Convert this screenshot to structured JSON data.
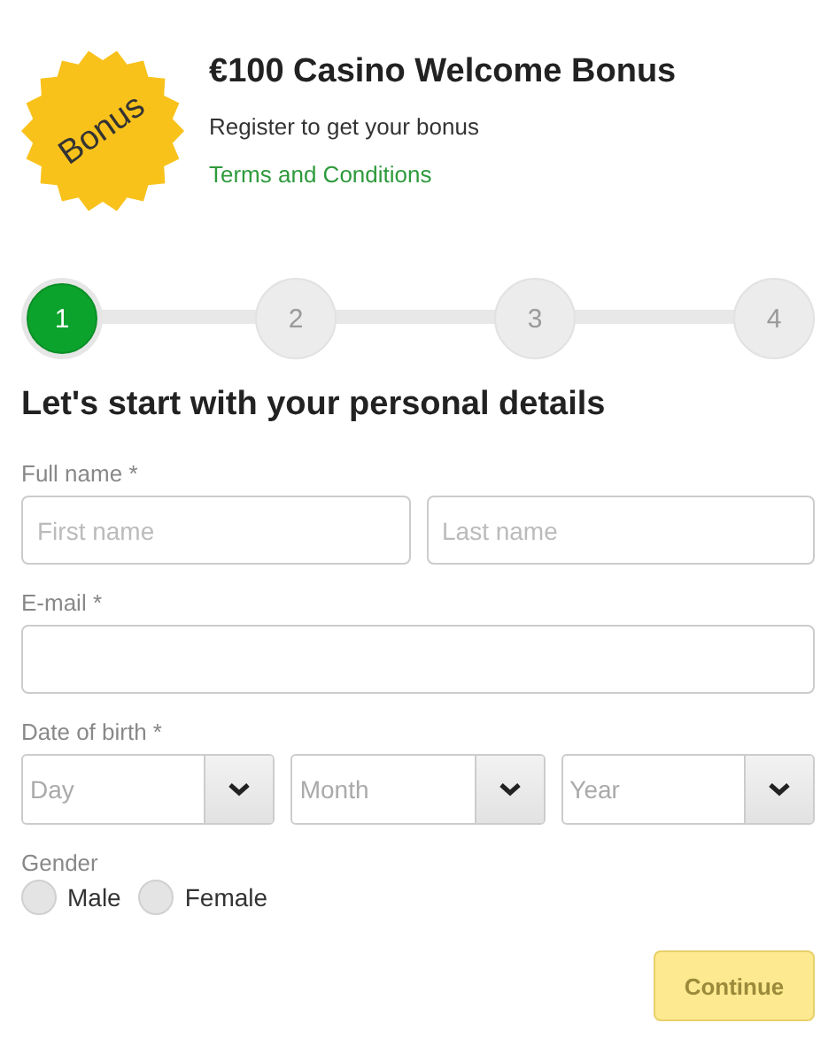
{
  "promo": {
    "badge": "Bonus",
    "title": "€100 Casino Welcome Bonus",
    "subtitle": "Register to get your bonus",
    "link": "Terms and Conditions"
  },
  "steps": [
    {
      "label": "1",
      "selected": true
    },
    {
      "label": "2",
      "selected": false
    },
    {
      "label": "3",
      "selected": false
    },
    {
      "label": "4",
      "selected": false
    }
  ],
  "heading": "Let's start with your personal details",
  "full_name": {
    "label": "Full name *",
    "fields": [
      {
        "placeholder": "First name"
      },
      {
        "placeholder": "Last name"
      }
    ]
  },
  "email": {
    "label": "E-mail *"
  },
  "date_of_birth": {
    "label": "Date of birth *",
    "selects": [
      {
        "placeholder": "Day"
      },
      {
        "placeholder": "Month"
      },
      {
        "placeholder": "Year"
      }
    ]
  },
  "gender": {
    "label": "Gender",
    "options": [
      {
        "label": "Male",
        "selected": false
      },
      {
        "label": "Female",
        "selected": false
      }
    ]
  },
  "continue_button": {
    "label": "Continue",
    "disabled": true
  }
}
